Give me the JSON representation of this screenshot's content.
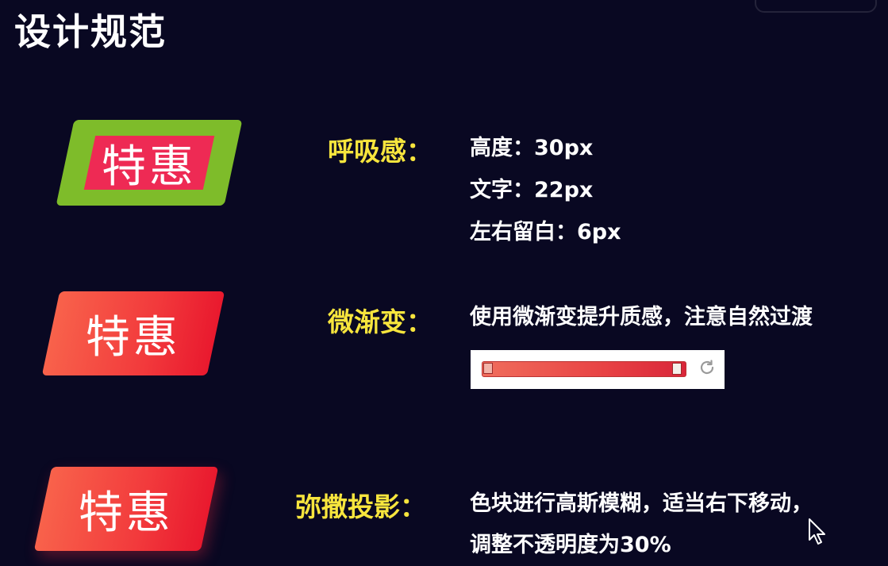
{
  "title": "设计规范",
  "tag_text": "特惠",
  "sections": {
    "breathing": {
      "label": "呼吸感：",
      "lines": [
        "高度：30px",
        "文字：22px",
        "左右留白：6px"
      ]
    },
    "gradient": {
      "label": "微渐变：",
      "text": "使用微渐变提升质感，注意自然过渡",
      "bar_colors": [
        "#f06d5c",
        "#d9263a"
      ]
    },
    "shadow": {
      "label": "弥撒投影：",
      "lines": [
        "色块进行高斯模糊，适当右下移动，",
        "调整不透明度为30%"
      ]
    }
  },
  "colors": {
    "background": "#090822",
    "label": "#f7e53d",
    "tag_green": "#7ebc2a",
    "tag_pink": "#ee2a54",
    "tag_red": "#f23a3c"
  },
  "icons": [
    "reset-icon",
    "mouse-cursor-icon"
  ]
}
